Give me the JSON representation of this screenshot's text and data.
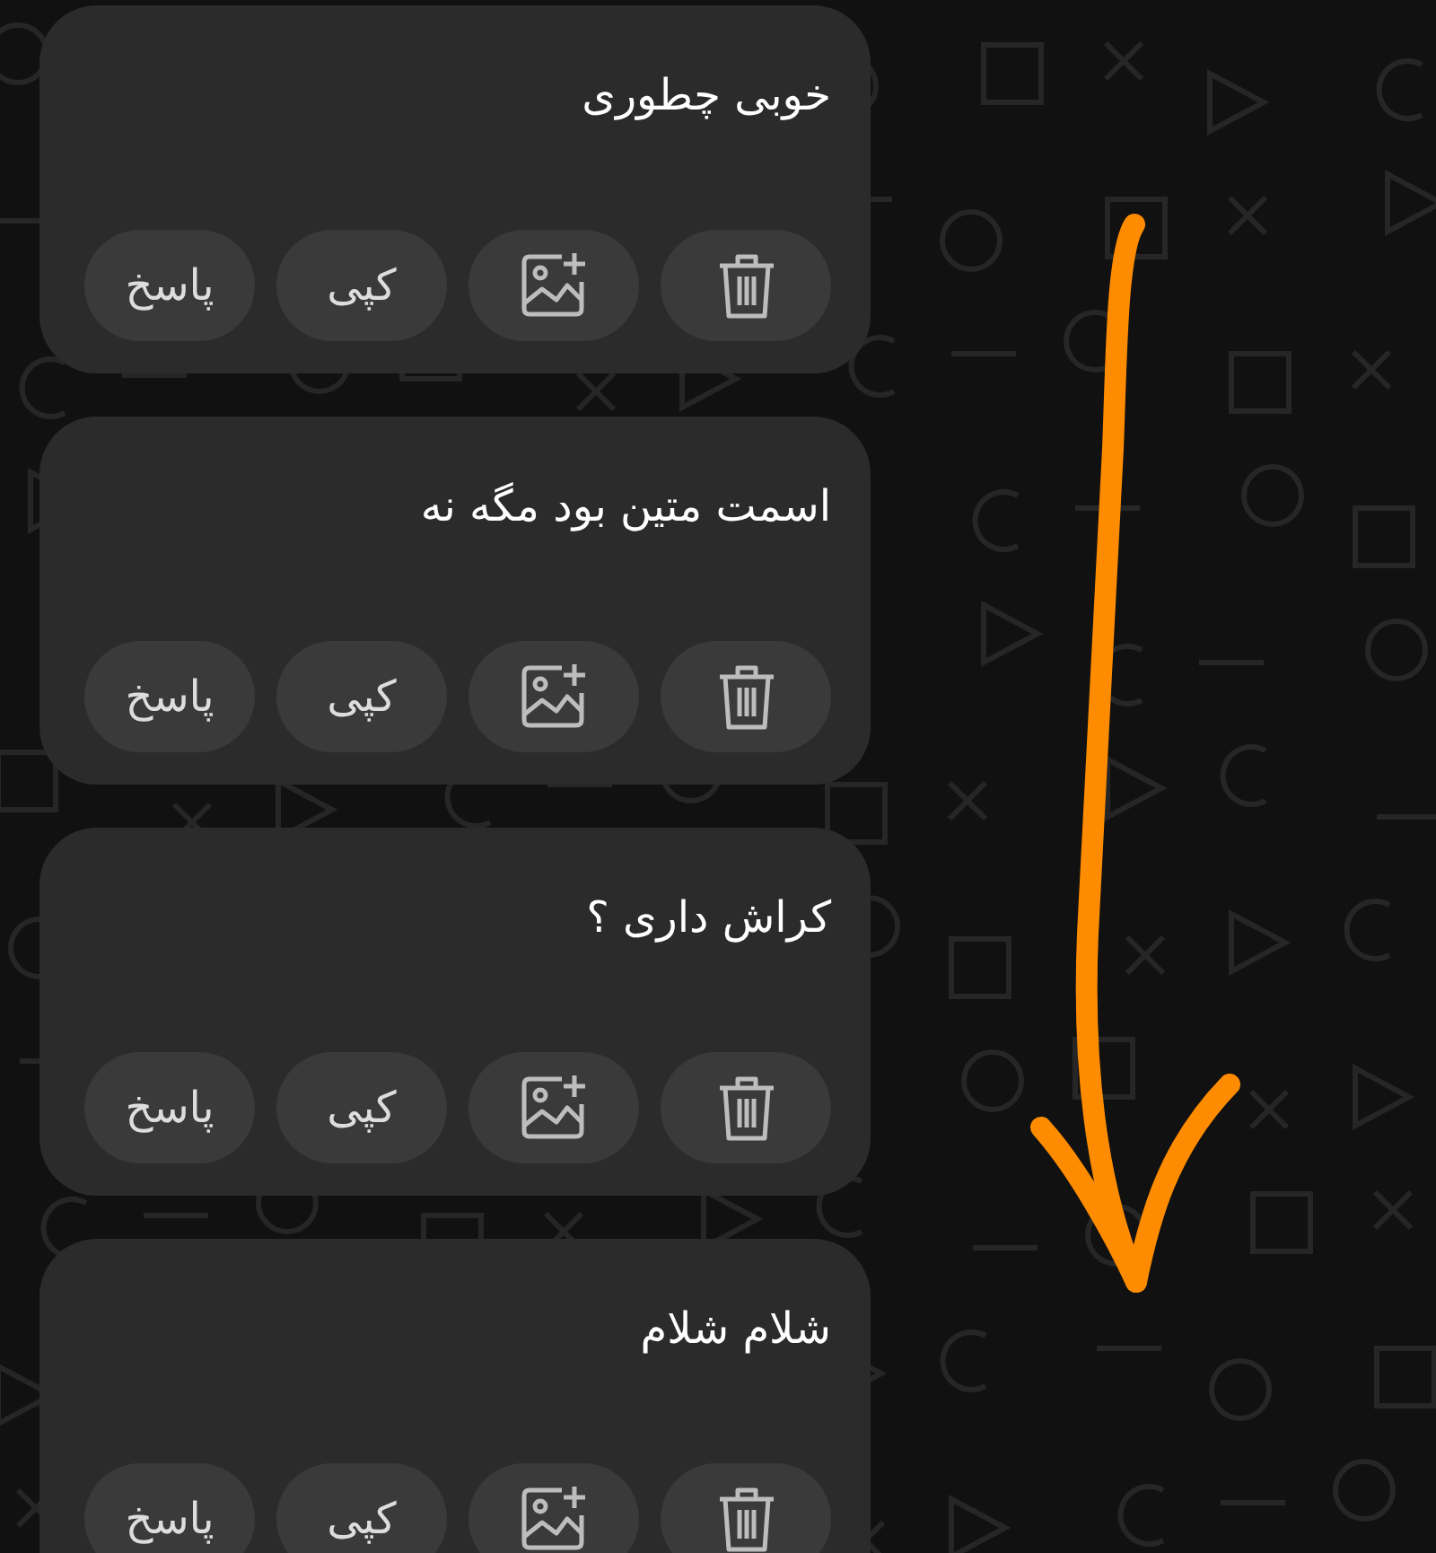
{
  "messages": [
    {
      "text": "خوبی چطوری",
      "actions": [
        {
          "kind": "delete"
        },
        {
          "kind": "image"
        },
        {
          "kind": "copy",
          "label": "کپی"
        },
        {
          "kind": "reply",
          "label": "پاسخ"
        }
      ]
    },
    {
      "text": "اسمت متین بود مگه نه",
      "actions": [
        {
          "kind": "delete"
        },
        {
          "kind": "image"
        },
        {
          "kind": "copy",
          "label": "کپی"
        },
        {
          "kind": "reply",
          "label": "پاسخ"
        }
      ]
    },
    {
      "text": "کراش داری ؟",
      "actions": [
        {
          "kind": "delete"
        },
        {
          "kind": "image"
        },
        {
          "kind": "copy",
          "label": "کپی"
        },
        {
          "kind": "reply",
          "label": "پاسخ"
        }
      ]
    },
    {
      "text": "شلام شلام",
      "actions": [
        {
          "kind": "delete"
        },
        {
          "kind": "image"
        },
        {
          "kind": "copy",
          "label": "کپی"
        },
        {
          "kind": "reply",
          "label": "پاسخ"
        }
      ]
    }
  ],
  "annotation": {
    "kind": "arrow"
  }
}
